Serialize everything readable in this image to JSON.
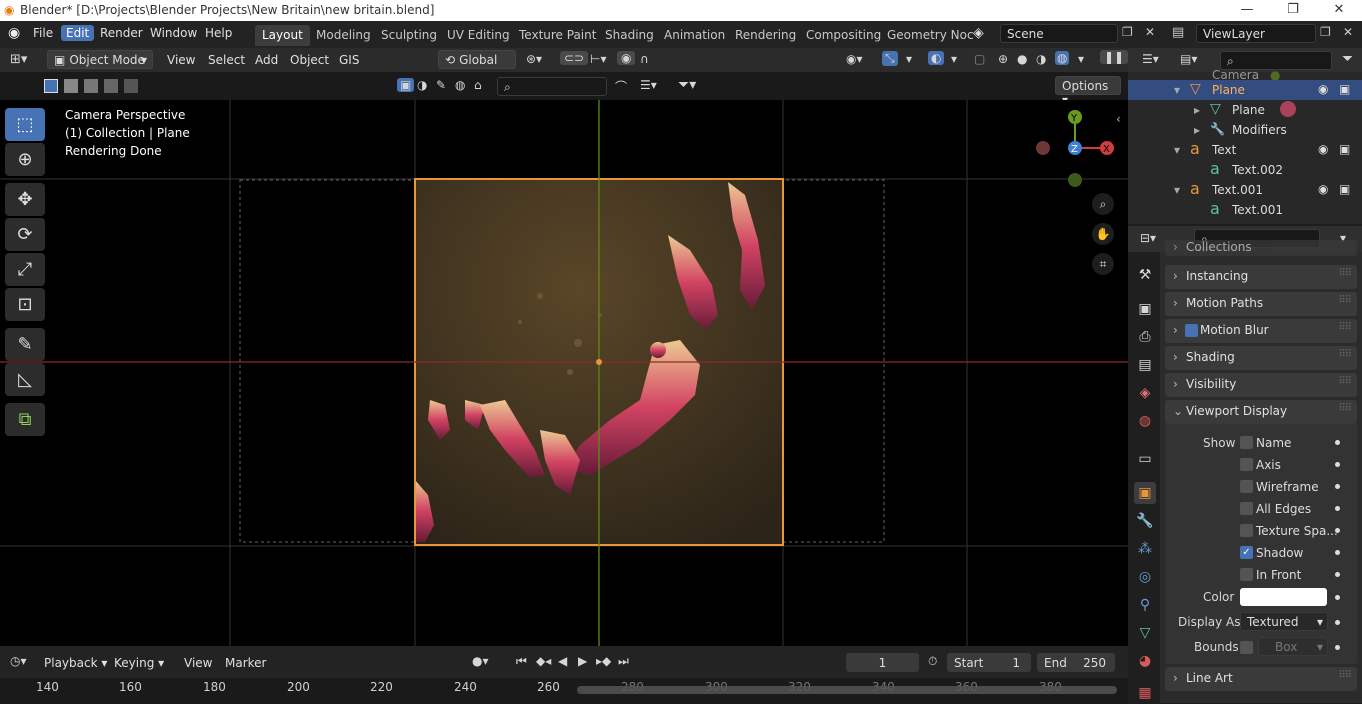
{
  "window": {
    "title": "Blender* [D:\\Projects\\Blender Projects\\New Britain\\new britain.blend]",
    "controls": [
      "—",
      "❐",
      "✕"
    ]
  },
  "menu": [
    "File",
    "Edit",
    "Render",
    "Window",
    "Help"
  ],
  "workspace_tabs": [
    "Layout",
    "Modeling",
    "Sculpting",
    "UV Editing",
    "Texture Paint",
    "Shading",
    "Animation",
    "Rendering",
    "Compositing",
    "Geometry Noc"
  ],
  "scene": {
    "label": "Scene",
    "viewlayer": "ViewLayer"
  },
  "viewport_header": {
    "mode": "Object Mode",
    "items": [
      "View",
      "Select",
      "Add",
      "Object",
      "GIS"
    ],
    "transform": "Global",
    "options": "Options"
  },
  "overlay": {
    "line1": "Camera Perspective",
    "line2": "(1) Collection | Plane",
    "line3": "Rendering Done"
  },
  "gizmo": {
    "y": "Y",
    "z": "Z",
    "x": "X"
  },
  "outliner": {
    "rows": [
      {
        "label": "Camera",
        "icon": "camera-icon"
      },
      {
        "label": "Plane",
        "icon": "mesh-object-icon",
        "selected": true
      },
      {
        "label": "Plane",
        "icon": "mesh-data-icon"
      },
      {
        "label": "Modifiers",
        "icon": "wrench-icon"
      },
      {
        "label": "Text",
        "icon": "text-object-icon"
      },
      {
        "label": "Text.002",
        "icon": "text-data-icon"
      },
      {
        "label": "Text.001",
        "icon": "text-object-icon"
      },
      {
        "label": "Text.001",
        "icon": "text-data-icon"
      }
    ]
  },
  "properties": {
    "panels": [
      "Collections",
      "Instancing",
      "Motion Paths",
      "Motion Blur",
      "Shading",
      "Visibility",
      "Viewport Display"
    ],
    "show_label": "Show",
    "show": [
      {
        "label": "Name",
        "checked": false
      },
      {
        "label": "Axis",
        "checked": false
      },
      {
        "label": "Wireframe",
        "checked": false
      },
      {
        "label": "All Edges",
        "checked": false
      },
      {
        "label": "Texture Spa...",
        "checked": false
      },
      {
        "label": "Shadow",
        "checked": true
      },
      {
        "label": "In Front",
        "checked": false
      }
    ],
    "color_label": "Color",
    "color_value": "#ffffff",
    "display_as_label": "Display As",
    "display_as_value": "Textured",
    "bounds_label": "Bounds",
    "bounds_value": "Box",
    "line_art": "Line Art"
  },
  "timeline": {
    "items": [
      "Playback",
      "Keying",
      "View",
      "Marker"
    ],
    "current_frame": "1",
    "start_label": "Start",
    "start": "1",
    "end_label": "End",
    "end": "250",
    "ticks": [
      "140",
      "160",
      "180",
      "200",
      "220",
      "240",
      "260",
      "280",
      "300",
      "320",
      "340",
      "360",
      "380"
    ]
  },
  "colors": {
    "accent": "#4772b3",
    "selection": "#e8963c",
    "x_axis": "#d03d3d",
    "y_axis": "#6a9a1f"
  }
}
